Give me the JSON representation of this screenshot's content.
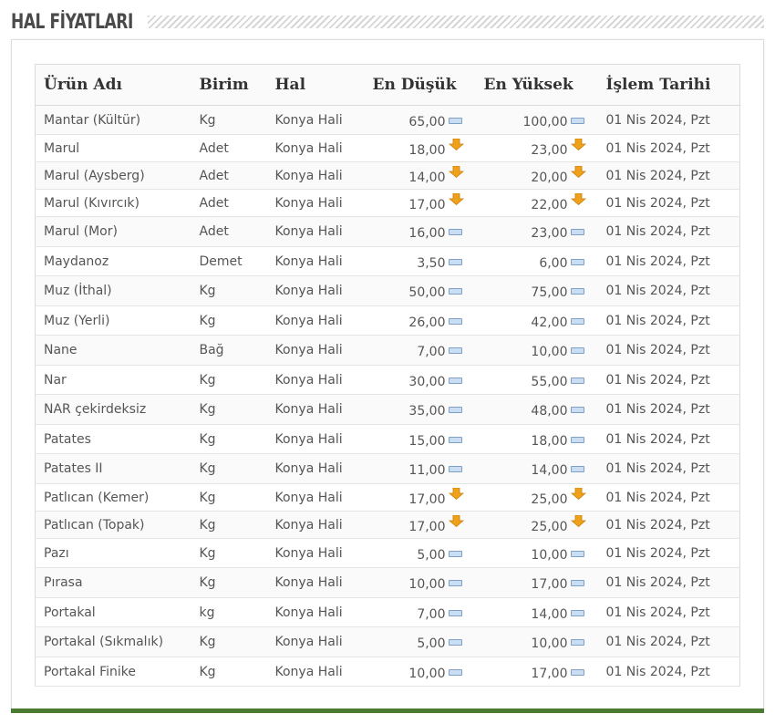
{
  "section": {
    "title": "HAL FİYATLARI"
  },
  "table": {
    "headers": [
      "Ürün Adı",
      "Birim",
      "Hal",
      "En Düşük",
      "En Yüksek",
      "İşlem Tarihi"
    ],
    "rows": [
      {
        "name": "Mantar (Kültür)",
        "unit": "Kg",
        "market": "Konya Hali",
        "low": "65,00",
        "low_trend": "same",
        "high": "100,00",
        "high_trend": "same",
        "date": "01 Nis 2024, Pzt"
      },
      {
        "name": "Marul",
        "unit": "Adet",
        "market": "Konya Hali",
        "low": "18,00",
        "low_trend": "down",
        "high": "23,00",
        "high_trend": "down",
        "date": "01 Nis 2024, Pzt"
      },
      {
        "name": "Marul (Aysberg)",
        "unit": "Adet",
        "market": "Konya Hali",
        "low": "14,00",
        "low_trend": "down",
        "high": "20,00",
        "high_trend": "down",
        "date": "01 Nis 2024, Pzt"
      },
      {
        "name": "Marul (Kıvırcık)",
        "unit": "Adet",
        "market": "Konya Hali",
        "low": "17,00",
        "low_trend": "down",
        "high": "22,00",
        "high_trend": "down",
        "date": "01 Nis 2024, Pzt"
      },
      {
        "name": "Marul (Mor)",
        "unit": "Adet",
        "market": "Konya Hali",
        "low": "16,00",
        "low_trend": "same",
        "high": "23,00",
        "high_trend": "same",
        "date": "01 Nis 2024, Pzt"
      },
      {
        "name": "Maydanoz",
        "unit": "Demet",
        "market": "Konya Hali",
        "low": "3,50",
        "low_trend": "same",
        "high": "6,00",
        "high_trend": "same",
        "date": "01 Nis 2024, Pzt"
      },
      {
        "name": "Muz (İthal)",
        "unit": "Kg",
        "market": "Konya Hali",
        "low": "50,00",
        "low_trend": "same",
        "high": "75,00",
        "high_trend": "same",
        "date": "01 Nis 2024, Pzt"
      },
      {
        "name": "Muz (Yerli)",
        "unit": "Kg",
        "market": "Konya Hali",
        "low": "26,00",
        "low_trend": "same",
        "high": "42,00",
        "high_trend": "same",
        "date": "01 Nis 2024, Pzt"
      },
      {
        "name": "Nane",
        "unit": "Bağ",
        "market": "Konya Hali",
        "low": "7,00",
        "low_trend": "same",
        "high": "10,00",
        "high_trend": "same",
        "date": "01 Nis 2024, Pzt"
      },
      {
        "name": "Nar",
        "unit": "Kg",
        "market": "Konya Hali",
        "low": "30,00",
        "low_trend": "same",
        "high": "55,00",
        "high_trend": "same",
        "date": "01 Nis 2024, Pzt"
      },
      {
        "name": "NAR çekirdeksiz",
        "unit": "Kg",
        "market": "Konya Hali",
        "low": "35,00",
        "low_trend": "same",
        "high": "48,00",
        "high_trend": "same",
        "date": "01 Nis 2024, Pzt"
      },
      {
        "name": "Patates",
        "unit": "Kg",
        "market": "Konya Hali",
        "low": "15,00",
        "low_trend": "same",
        "high": "18,00",
        "high_trend": "same",
        "date": "01 Nis 2024, Pzt"
      },
      {
        "name": "Patates II",
        "unit": "Kg",
        "market": "Konya Hali",
        "low": "11,00",
        "low_trend": "same",
        "high": "14,00",
        "high_trend": "same",
        "date": "01 Nis 2024, Pzt"
      },
      {
        "name": "Patlıcan (Kemer)",
        "unit": "Kg",
        "market": "Konya Hali",
        "low": "17,00",
        "low_trend": "down",
        "high": "25,00",
        "high_trend": "down",
        "date": "01 Nis 2024, Pzt"
      },
      {
        "name": "Patlıcan (Topak)",
        "unit": "Kg",
        "market": "Konya Hali",
        "low": "17,00",
        "low_trend": "down",
        "high": "25,00",
        "high_trend": "down",
        "date": "01 Nis 2024, Pzt"
      },
      {
        "name": "Pazı",
        "unit": "Kg",
        "market": "Konya Hali",
        "low": "5,00",
        "low_trend": "same",
        "high": "10,00",
        "high_trend": "same",
        "date": "01 Nis 2024, Pzt"
      },
      {
        "name": "Pırasa",
        "unit": "Kg",
        "market": "Konya Hali",
        "low": "10,00",
        "low_trend": "same",
        "high": "17,00",
        "high_trend": "same",
        "date": "01 Nis 2024, Pzt"
      },
      {
        "name": "Portakal",
        "unit": "kg",
        "market": "Konya Hali",
        "low": "7,00",
        "low_trend": "same",
        "high": "14,00",
        "high_trend": "same",
        "date": "01 Nis 2024, Pzt"
      },
      {
        "name": "Portakal (Sıkmalık)",
        "unit": "Kg",
        "market": "Konya Hali",
        "low": "5,00",
        "low_trend": "same",
        "high": "10,00",
        "high_trend": "same",
        "date": "01 Nis 2024, Pzt"
      },
      {
        "name": "Portakal Finike",
        "unit": "Kg",
        "market": "Konya Hali",
        "low": "10,00",
        "low_trend": "same",
        "high": "17,00",
        "high_trend": "same",
        "date": "01 Nis 2024, Pzt"
      }
    ]
  },
  "icons": {
    "same": "no-change-icon",
    "down": "down-arrow-icon"
  },
  "colors": {
    "accent_bar": "#4b7b33",
    "down_arrow": "#f0a11a",
    "no_change": "#c9ddf3"
  }
}
